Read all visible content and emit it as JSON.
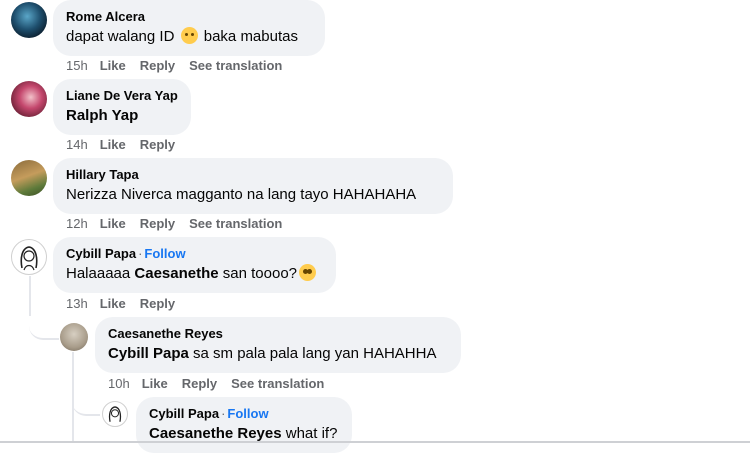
{
  "icons": {
    "avatar": "avatar-photo",
    "emoji_grin": "grinning-squinting-face",
    "emoji_plead": "pleading-face"
  },
  "colors": {
    "bubble": "#f0f2f5",
    "follow": "#1877f2",
    "meta": "#65676b"
  },
  "comments": [
    {
      "author": "Rome Alcera",
      "text_before": "dapat walang ID ",
      "text_after": " baka mabutas",
      "time": "15h",
      "like": "Like",
      "reply": "Reply",
      "translate": "See translation"
    },
    {
      "author": "Liane De Vera Yap",
      "mention": "Ralph Yap",
      "time": "14h",
      "like": "Like",
      "reply": "Reply"
    },
    {
      "author": "Hillary Tapa",
      "text": "Nerizza Niverca magganto na lang tayo HAHAHAHA",
      "time": "12h",
      "like": "Like",
      "reply": "Reply",
      "translate": "See translation"
    },
    {
      "author": "Cybill Papa",
      "separator": "·",
      "follow": "Follow",
      "text_before": "Halaaaaa ",
      "mention": "Caesanethe",
      "text_after": " san toooo?",
      "time": "13h",
      "like": "Like",
      "reply": "Reply"
    },
    {
      "author": "Caesanethe Reyes",
      "mention": "Cybill Papa",
      "text_after": " sa sm pala pala lang yan HAHAHHA",
      "time": "10h",
      "like": "Like",
      "reply": "Reply",
      "translate": "See translation"
    },
    {
      "author": "Cybill Papa",
      "separator": "·",
      "follow": "Follow",
      "mention": "Caesanethe Reyes",
      "text_after": " what if?"
    }
  ]
}
